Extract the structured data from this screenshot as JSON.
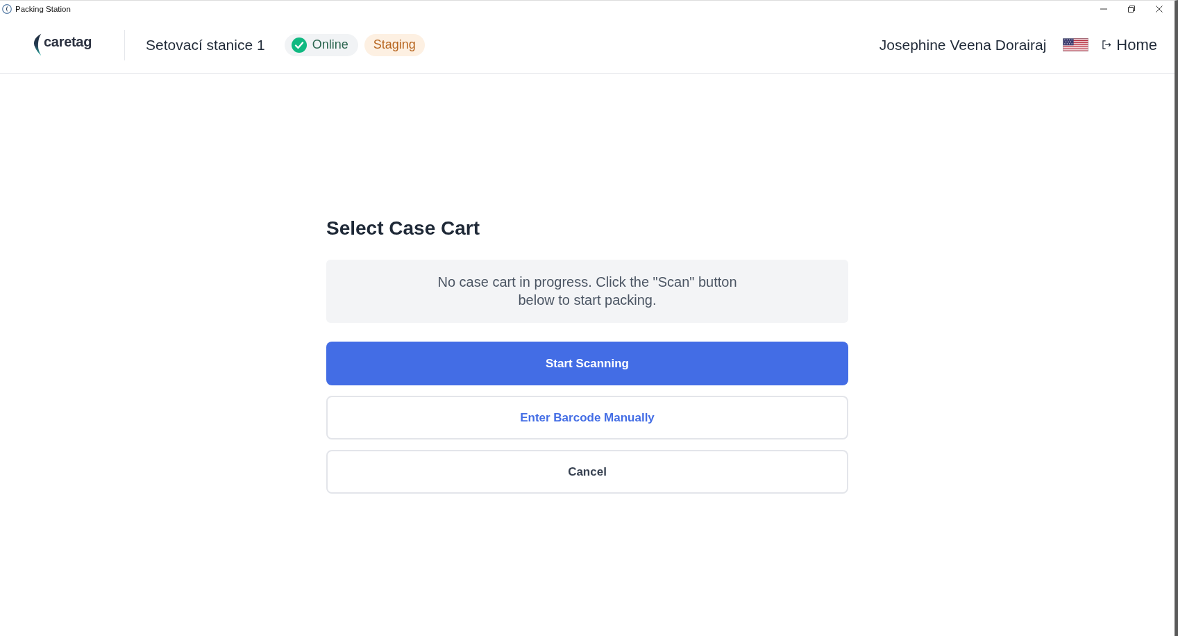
{
  "window": {
    "title": "Packing Station"
  },
  "header": {
    "logo": "caretag",
    "station": "Setovací stanice 1",
    "status": {
      "label": "Online",
      "online": true
    },
    "environment": "Staging",
    "user": "Josephine Veena Dorairaj",
    "home": "Home"
  },
  "main": {
    "title": "Select Case Cart",
    "message": "No case cart in progress. Click the \"Scan\" button below to start packing.",
    "buttons": [
      {
        "label": "Start Scanning",
        "kind": "primary"
      },
      {
        "label": "Enter Barcode Manually",
        "kind": "secondary"
      },
      {
        "label": "Cancel",
        "kind": "neutral"
      }
    ]
  }
}
